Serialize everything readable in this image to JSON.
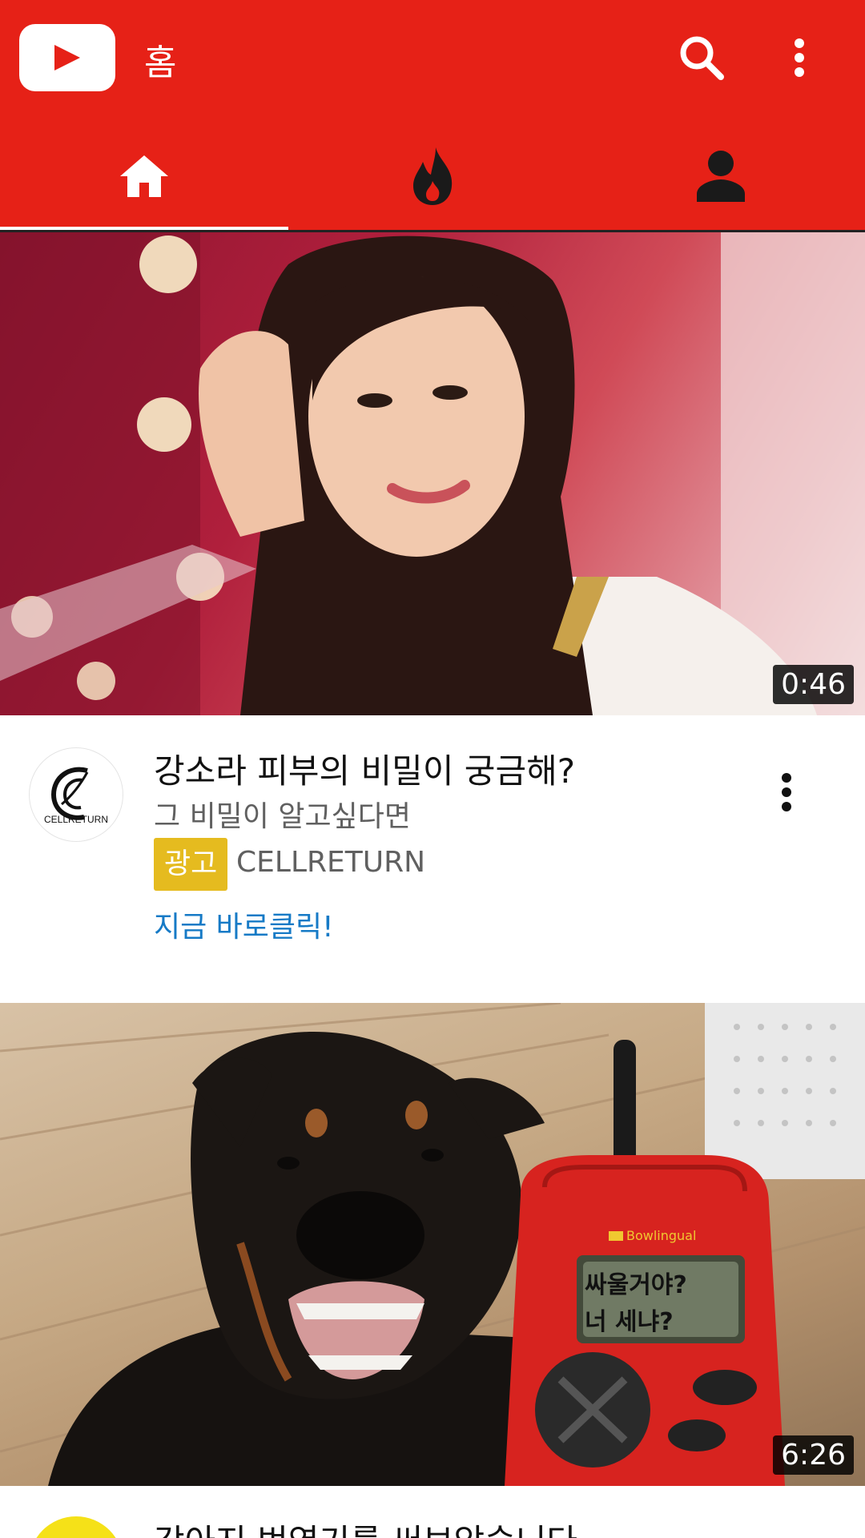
{
  "header": {
    "title": "홈",
    "icons": {
      "logo": "youtube-play-icon",
      "search": "search-icon",
      "more": "more-vert-icon"
    },
    "tabs": [
      {
        "name": "home",
        "icon": "home-icon",
        "selected": true
      },
      {
        "name": "trending",
        "icon": "flame-icon",
        "selected": false
      },
      {
        "name": "account",
        "icon": "person-icon",
        "selected": false
      }
    ],
    "colors": {
      "bar": "#e62117",
      "inactive_icon": "#1a1a1a",
      "active_icon": "#ffffff"
    }
  },
  "feed": [
    {
      "duration": "0:46",
      "title": "강소라 피부의 비밀이 궁금해?",
      "subtitle": "그 비밀이 알고싶다면",
      "badge": "광고",
      "channel": "CELLRETURN",
      "avatar_text": "CELLRETURN",
      "cta": "지금 바로클릭!"
    },
    {
      "duration": "6:26",
      "screen_text": [
        "싸울거야?",
        "너 세냐?"
      ],
      "device_brand": "Bowlingual",
      "title": "강아지 번역기를 써보았습니다"
    }
  ]
}
